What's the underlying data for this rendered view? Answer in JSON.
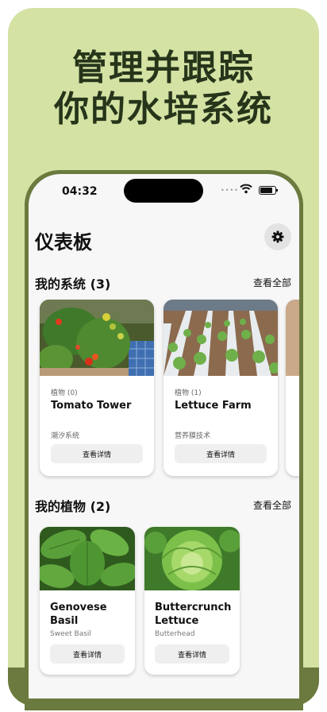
{
  "headline": {
    "line1": "管理并跟踪",
    "line2": "你的水培系统"
  },
  "status_bar": {
    "time": "04:32"
  },
  "dashboard": {
    "title": "仪表板"
  },
  "systems_section": {
    "title": "我的系统 (3)",
    "view_all": "查看全部",
    "cards": [
      {
        "count": "植物 (0)",
        "name": "Tomato Tower",
        "type": "潮汐系统",
        "button": "查看详情"
      },
      {
        "count": "植物 (1)",
        "name": "Lettuce Farm",
        "type": "营养膜技术",
        "button": "查看详情"
      }
    ]
  },
  "plants_section": {
    "title": "我的植物 (2)",
    "view_all": "查看全部",
    "cards": [
      {
        "name": "Genovese Basil",
        "variety": "Sweet Basil",
        "button": "查看详情"
      },
      {
        "name": "Buttercrunch Lettuce",
        "variety": "Butterhead",
        "button": "查看详情"
      }
    ]
  },
  "icons": {
    "settings": "gear-icon",
    "wifi": "wifi-icon",
    "battery": "battery-icon"
  },
  "colors": {
    "background": "#d4e2a4",
    "frame": "#6b7a3e",
    "headline": "#26351a"
  }
}
